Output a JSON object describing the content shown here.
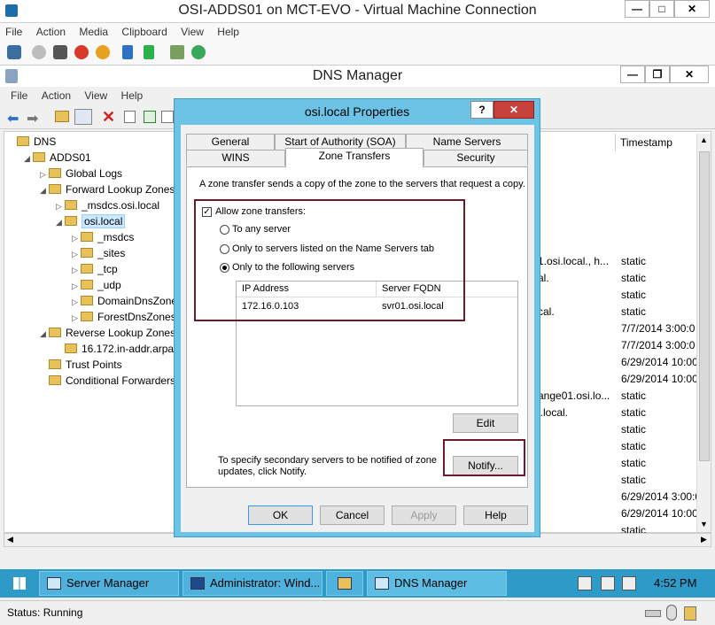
{
  "vm": {
    "title": "OSI-ADDS01 on MCT-EVO - Virtual Machine Connection",
    "menu": [
      "File",
      "Action",
      "Media",
      "Clipboard",
      "View",
      "Help"
    ],
    "status": "Status: Running"
  },
  "dns": {
    "title": "DNS Manager",
    "menu": [
      "File",
      "Action",
      "View",
      "Help"
    ],
    "tree": [
      {
        "label": "DNS",
        "indent": 0,
        "exp": ""
      },
      {
        "label": "ADDS01",
        "indent": 1,
        "exp": "◢"
      },
      {
        "label": "Global Logs",
        "indent": 2,
        "exp": "▷"
      },
      {
        "label": "Forward Lookup Zones",
        "indent": 2,
        "exp": "◢"
      },
      {
        "label": "_msdcs.osi.local",
        "indent": 3,
        "exp": "▷"
      },
      {
        "label": "osi.local",
        "indent": 3,
        "exp": "◢"
      },
      {
        "label": "_msdcs",
        "indent": 4,
        "exp": "▷"
      },
      {
        "label": "_sites",
        "indent": 4,
        "exp": "▷"
      },
      {
        "label": "_tcp",
        "indent": 4,
        "exp": "▷"
      },
      {
        "label": "_udp",
        "indent": 4,
        "exp": "▷"
      },
      {
        "label": "DomainDnsZones",
        "indent": 4,
        "exp": "▷"
      },
      {
        "label": "ForestDnsZones",
        "indent": 4,
        "exp": "▷"
      },
      {
        "label": "Reverse Lookup Zones",
        "indent": 2,
        "exp": "◢"
      },
      {
        "label": "16.172.in-addr.arpa",
        "indent": 3,
        "exp": ""
      },
      {
        "label": "Trust Points",
        "indent": 2,
        "exp": ""
      },
      {
        "label": "Conditional Forwarders",
        "indent": 2,
        "exp": ""
      }
    ],
    "right_header": "Timestamp",
    "right_data": [
      {
        "data": "1.osi.local., h...",
        "ts": "static"
      },
      {
        "data": "al.",
        "ts": "static"
      },
      {
        "data": "",
        "ts": "static"
      },
      {
        "data": "cal.",
        "ts": "static"
      },
      {
        "data": "",
        "ts": "7/7/2014 3:00:0"
      },
      {
        "data": "",
        "ts": "7/7/2014 3:00:0"
      },
      {
        "data": "",
        "ts": "6/29/2014 10:00:"
      },
      {
        "data": "",
        "ts": "6/29/2014 10:00:"
      },
      {
        "data": "ange01.osi.lo...",
        "ts": "static"
      },
      {
        "data": "i.local.",
        "ts": "static"
      },
      {
        "data": "",
        "ts": "static"
      },
      {
        "data": "",
        "ts": "static"
      },
      {
        "data": "",
        "ts": "static"
      },
      {
        "data": "",
        "ts": "static"
      },
      {
        "data": "",
        "ts": "6/29/2014 3:00:0"
      },
      {
        "data": "",
        "ts": "6/29/2014 10:00:"
      },
      {
        "data": "",
        "ts": "static"
      }
    ]
  },
  "dialog": {
    "title": "osi.local Properties",
    "help_btn": "?",
    "close_btn": "✕",
    "tabs_row1": [
      "General",
      "Start of Authority (SOA)",
      "Name Servers"
    ],
    "tabs_row2": [
      "WINS",
      "Zone Transfers",
      "Security"
    ],
    "description": "A zone transfer sends a copy of the zone to the servers that request a copy.",
    "allow_label": "Allow zone transfers:",
    "allow_checked": true,
    "radio_any": "To any server",
    "radio_ns": "Only to servers listed on the Name Servers tab",
    "radio_following": "Only to the following servers",
    "selected_radio": "following",
    "col_ip": "IP Address",
    "col_fqdn": "Server FQDN",
    "servers": [
      {
        "ip": "172.16.0.103",
        "fqdn": "svr01.osi.local"
      }
    ],
    "edit_btn": "Edit",
    "notify_text": "To specify secondary servers to be notified of zone updates, click Notify.",
    "notify_btn": "Notify...",
    "ok": "OK",
    "cancel": "Cancel",
    "apply": "Apply",
    "help": "Help"
  },
  "taskbar": {
    "items": [
      "Server Manager",
      "Administrator: Wind...",
      "",
      "DNS Manager"
    ],
    "time": "4:52 PM"
  },
  "colors": {
    "accent": "#6dc3e6",
    "taskbar": "#2e9ac7",
    "highlight": "#6d1a2a"
  }
}
